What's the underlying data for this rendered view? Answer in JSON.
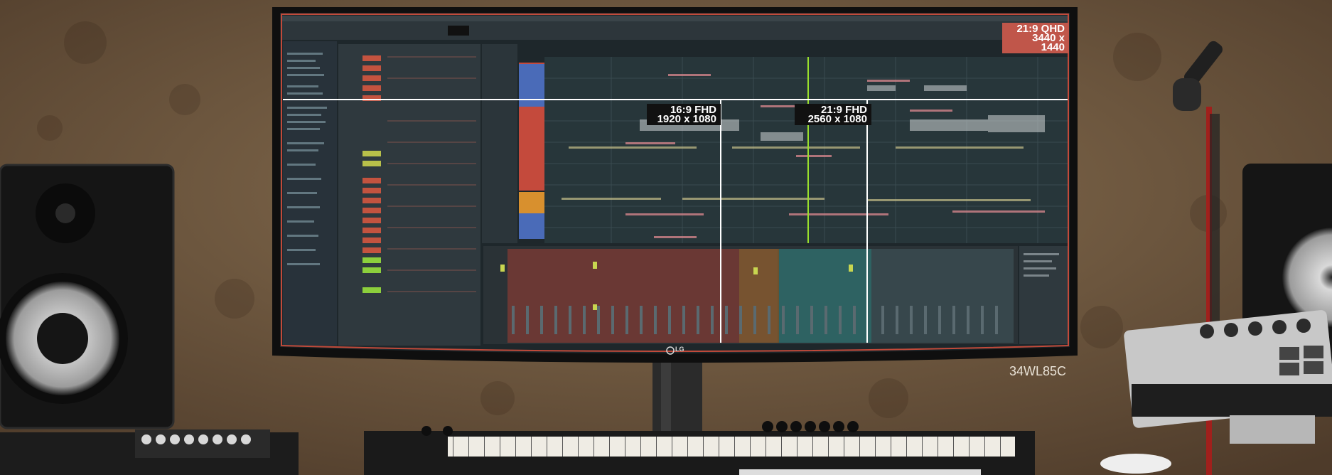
{
  "colors": {
    "wall": "#7a6247",
    "wall_dark": "#5b4632",
    "bezel": "#111111",
    "screen_bg": "#1f272b",
    "daw_panel": "#2a3338",
    "accent_red": "#c44a3c",
    "accent_green": "#8ccf3c",
    "mixer_teal": "#2f6b6a",
    "mixer_red": "#7a3a34",
    "white": "#ffffff"
  },
  "overlays": {
    "qhd": {
      "line1": "21:9 QHD",
      "line2": "3440 x 1440"
    },
    "fhd169": {
      "line1": "16:9 FHD",
      "line2": "1920 x 1080"
    },
    "fhd219": {
      "line1": "21:9 FHD",
      "line2": "2560 x 1080"
    }
  },
  "brand_logo": "LG",
  "model": "34WL85C"
}
